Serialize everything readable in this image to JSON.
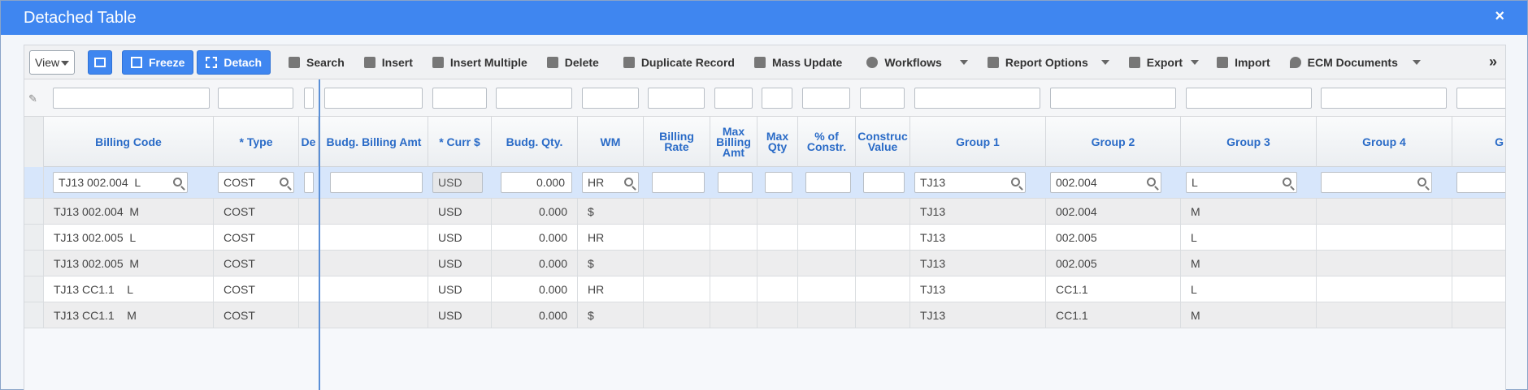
{
  "window": {
    "title": "Detached Table",
    "close_glyph": "×"
  },
  "toolbar": {
    "view_label": "View",
    "freeze_label": "Freeze",
    "detach_label": "Detach",
    "search_label": "Search",
    "insert_label": "Insert",
    "insert_multiple_label": "Insert Multiple",
    "delete_label": "Delete",
    "duplicate_label": "Duplicate Record",
    "mass_update_label": "Mass Update",
    "workflows_label": "Workflows",
    "report_options_label": "Report Options",
    "export_label": "Export",
    "import_label": "Import",
    "ecm_label": "ECM Documents",
    "more_glyph": "»"
  },
  "columns": {
    "billing_code": "Billing Code",
    "type": "* Type",
    "de": "De",
    "budg_billing_amt": "Budg. Billing Amt",
    "curr": "* Curr $",
    "budg_qty": "Budg. Qty.",
    "wm": "WM",
    "billing_rate": "Billing Rate",
    "max_billing_amt": "Max Billing Amt",
    "max_qty": "Max Qty",
    "pct_constr": "% of Constr.",
    "construc_value": "Construc Value",
    "group1": "Group 1",
    "group2": "Group 2",
    "group3": "Group 3",
    "group4": "Group 4",
    "g": "G"
  },
  "selected_row": {
    "billing_code": "TJ13 002.004  L",
    "type": "COST",
    "curr": "USD",
    "budg_qty": "0.000",
    "wm": "HR",
    "group1": "TJ13",
    "group2": "002.004",
    "group3": "L"
  },
  "rows": [
    {
      "billing_code": "TJ13 002.004  M",
      "type": "COST",
      "curr": "USD",
      "budg_qty": "0.000",
      "wm": "$",
      "group1": "TJ13",
      "group2": "002.004",
      "group3": "M"
    },
    {
      "billing_code": "TJ13 002.005  L",
      "type": "COST",
      "curr": "USD",
      "budg_qty": "0.000",
      "wm": "HR",
      "group1": "TJ13",
      "group2": "002.005",
      "group3": "L"
    },
    {
      "billing_code": "TJ13 002.005  M",
      "type": "COST",
      "curr": "USD",
      "budg_qty": "0.000",
      "wm": "$",
      "group1": "TJ13",
      "group2": "002.005",
      "group3": "M"
    },
    {
      "billing_code": "TJ13 CC1.1    L",
      "type": "COST",
      "curr": "USD",
      "budg_qty": "0.000",
      "wm": "HR",
      "group1": "TJ13",
      "group2": "CC1.1",
      "group3": "L"
    },
    {
      "billing_code": "TJ13 CC1.1    M",
      "type": "COST",
      "curr": "USD",
      "budg_qty": "0.000",
      "wm": "$",
      "group1": "TJ13",
      "group2": "CC1.1",
      "group3": "M"
    }
  ]
}
